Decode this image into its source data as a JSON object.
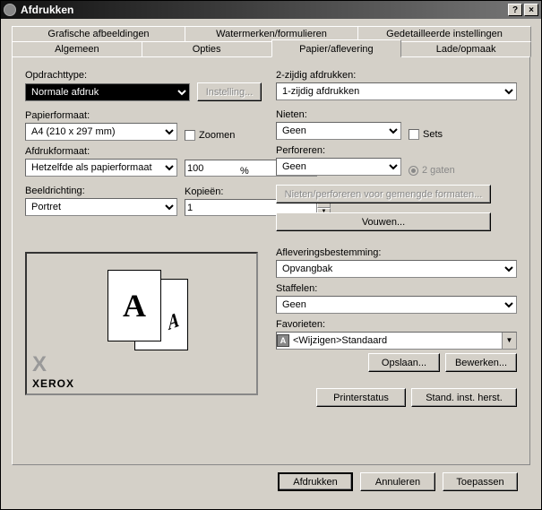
{
  "window": {
    "title": "Afdrukken",
    "help_btn": "?",
    "close_btn": "×"
  },
  "tabs": {
    "row1": [
      "Grafische afbeeldingen",
      "Watermerken/formulieren",
      "Gedetailleerde instellingen"
    ],
    "row2": [
      "Algemeen",
      "Opties",
      "Papier/aflevering",
      "Lade/opmaak"
    ],
    "active": "Papier/aflevering"
  },
  "left": {
    "job_type_label": "Opdrachttype:",
    "job_type_value": "Normale afdruk",
    "settings_btn": "Instelling...",
    "paper_size_label": "Papierformaat:",
    "paper_size_value": "A4 (210 x 297 mm)",
    "zoom_label": "Zoomen",
    "zoom_value": "100",
    "pct": "%",
    "print_size_label": "Afdrukformaat:",
    "print_size_value": "Hetzelfde als papierformaat",
    "orientation_label": "Beeldrichting:",
    "orientation_value": "Portret",
    "copies_label": "Kopieën:",
    "copies_value": "1",
    "logo_text": "XEROX"
  },
  "right": {
    "two_sided_label": "2-zijdig afdrukken:",
    "two_sided_value": "1-zijdig afdrukken",
    "staple_label": "Nieten:",
    "staple_value": "Geen",
    "sets_label": "Sets",
    "punch_label": "Perforeren:",
    "punch_value": "Geen",
    "holes_label": "2 gaten",
    "mixed_btn": "Nieten/perforeren voor gemengde formaten...",
    "fold_btn": "Vouwen...",
    "output_label": "Afleveringsbestemming:",
    "output_value": "Opvangbak",
    "collate_label": "Staffelen:",
    "collate_value": "Geen",
    "favorites_label": "Favorieten:",
    "favorites_value": "<Wijzigen>Standaard",
    "save_btn": "Opslaan...",
    "edit_btn": "Bewerken...",
    "status_btn": "Printerstatus",
    "reset_btn": "Stand. inst. herst."
  },
  "bottom": {
    "print": "Afdrukken",
    "cancel": "Annuleren",
    "apply": "Toepassen"
  }
}
